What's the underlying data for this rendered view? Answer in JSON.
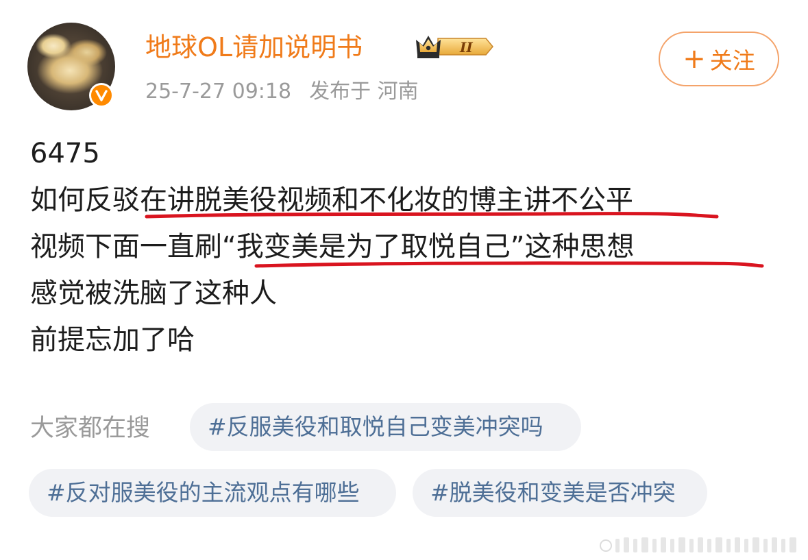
{
  "header": {
    "username": "地球OL请加说明书",
    "vip_level": "II",
    "timestamp": "25-7-27 09:18",
    "location": "发布于 河南",
    "follow_label": "关注",
    "follow_plus": "+"
  },
  "post": {
    "lines": [
      "6475",
      "如何反驳在讲脱美役视频和不化妆的博主讲不公平",
      "视频下面一直刷“我变美是为了取悦自己”这种思想",
      "感觉被洗脑了这种人",
      "前提忘加了哈"
    ]
  },
  "search": {
    "label": "大家都在搜",
    "tags": [
      "#反服美役和取悦自己变美冲突吗",
      "#反对服美役的主流观点有哪些",
      "#脱美役和变美是否冲突"
    ]
  },
  "colors": {
    "username": "#f07b1a",
    "underline": "#d9141f",
    "tag_text": "#4e6f96",
    "tag_bg": "#f1f2f5",
    "verified_badge": "#ff8a00"
  },
  "icons": {
    "verified": "v-verified-icon",
    "vip": "crown-vip-icon",
    "watermark": "weibo-watermark-icon"
  }
}
